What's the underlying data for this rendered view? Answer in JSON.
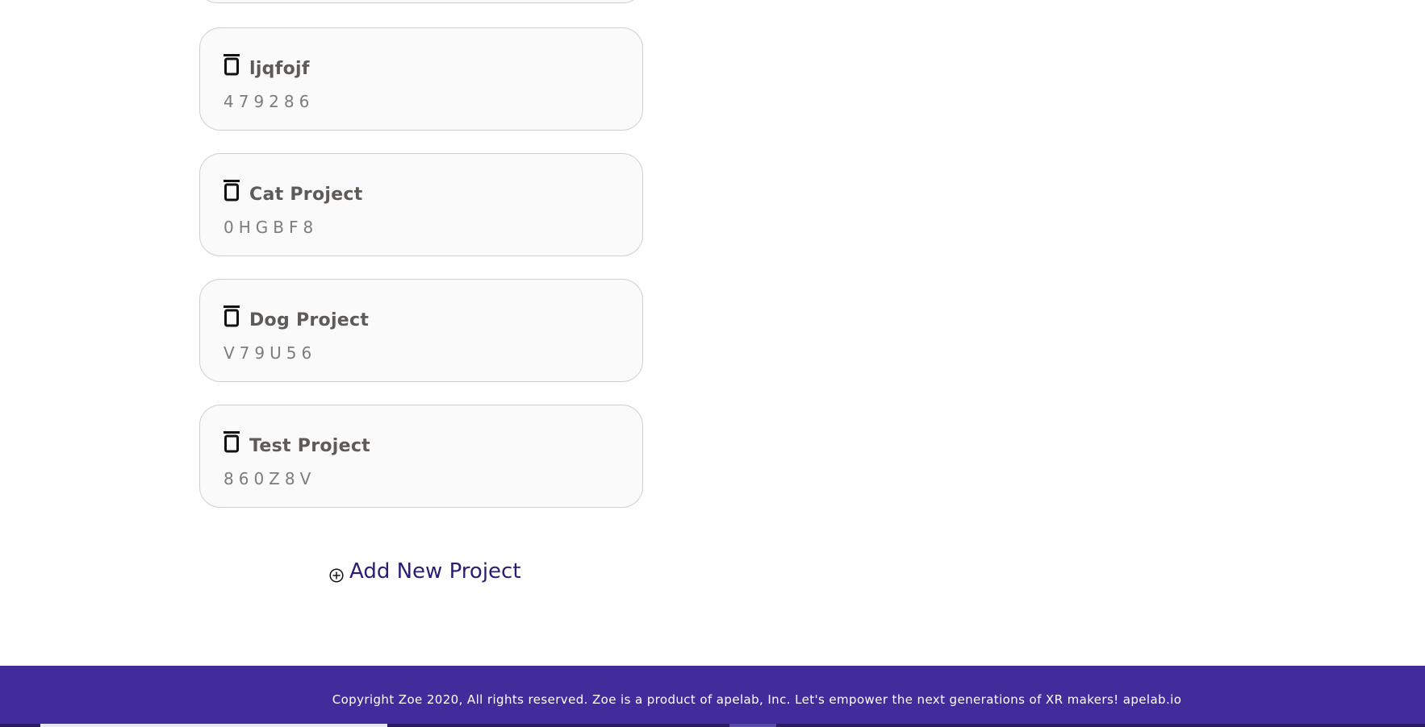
{
  "projects": [
    {
      "name": "ljqfojf",
      "code": "479286",
      "icon": "trash-icon"
    },
    {
      "name": "Cat Project",
      "code": "0HGBF8",
      "icon": "trash-icon"
    },
    {
      "name": "Dog Project",
      "code": "V79U56",
      "icon": "trash-icon"
    },
    {
      "name": "Test Project",
      "code": "860Z8V",
      "icon": "trash-icon"
    }
  ],
  "add_project": {
    "label": "Add New Project",
    "icon": "plus-circle-icon"
  },
  "footer": {
    "text": "Copyright Zoe 2020, All rights reserved. Zoe is a product of apelab, Inc. Let's empower the next generations of XR makers! apelab.io"
  },
  "colors": {
    "footer_bg": "#422c9b",
    "add_project_text": "#2b1d73",
    "card_bg": "#fafafa",
    "card_border": "#cfcfcf"
  }
}
